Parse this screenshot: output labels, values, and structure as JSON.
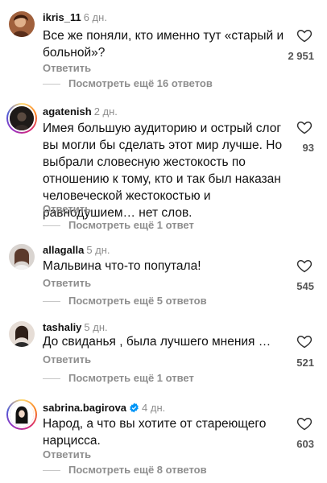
{
  "comments": [
    {
      "username": "ikris_11",
      "time": "6 дн.",
      "text": "Все же поняли, кто именно тут «старый и больной»?",
      "reply_label": "Ответить",
      "more_replies": "Посмотреть ещё 16 ответов",
      "likes": "2 951",
      "avatar_icon": "user-avatar-icon"
    },
    {
      "username": "agatenish",
      "time": "2 дн.",
      "text": "Имея большую аудиторию  и острый слог вы могли бы сделать этот мир лучше. Но выбрали словесную жестокость по отношению к тому, кто и так был наказан человеческой жестокостью и равнодушием… нет слов.",
      "reply_label": "Ответить",
      "more_replies": "Посмотреть ещё 1 ответ",
      "likes": "93",
      "avatar_icon": "user-avatar-icon"
    },
    {
      "username": "allagalla",
      "time": "5 дн.",
      "text": "Мальвина что-то попутала!",
      "reply_label": "Ответить",
      "more_replies": "Посмотреть ещё 5 ответов",
      "likes": "545",
      "avatar_icon": "user-avatar-icon"
    },
    {
      "username": "tashaliy",
      "time": "5 дн.",
      "text": "До свиданья , была лучшего мнения …",
      "reply_label": "Ответить",
      "more_replies": "Посмотреть ещё 1 ответ",
      "likes": "521",
      "avatar_icon": "user-avatar-icon"
    },
    {
      "username": "sabrina.bagirova",
      "time": "4 дн.",
      "text": "Народ, а что вы хотите от стареющего нарцисса.",
      "reply_label": "Ответить",
      "more_replies": "Посмотреть ещё 8 ответов",
      "likes": "603",
      "verified": true,
      "avatar_icon": "user-avatar-icon"
    }
  ],
  "colors": {
    "secondary_text": "#8e8e8e",
    "primary_text": "#111111",
    "verified_badge": "#0095f6"
  }
}
